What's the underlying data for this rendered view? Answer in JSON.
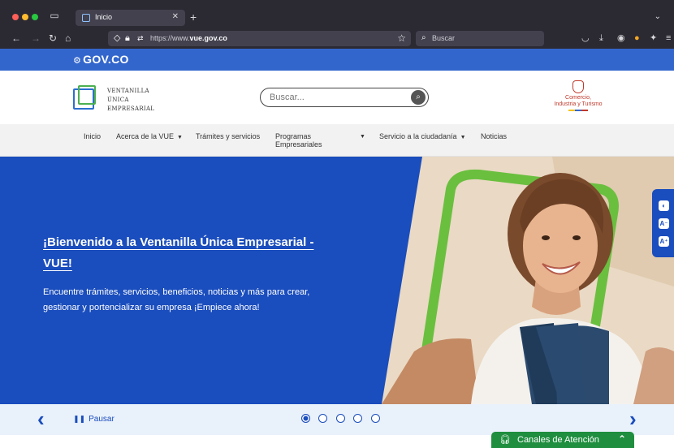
{
  "browser": {
    "tab_title": "Inicio",
    "tab_close": "✕",
    "new_tab": "+",
    "url_prefix": "https://www.",
    "url_domain": "vue.gov.co",
    "search_placeholder": "Buscar"
  },
  "gov_bar": {
    "logo": "GOV.CO"
  },
  "header": {
    "vue_logo_lines": [
      "VENTANILLA",
      "ÚNICA",
      "EMPRESARIAL"
    ],
    "search_placeholder": "Buscar...",
    "ministry_line1": "Comercio,",
    "ministry_line2": "Industria y Turismo"
  },
  "menu": {
    "items": [
      {
        "label": "Inicio",
        "dropdown": false
      },
      {
        "label": "Acerca de la VUE",
        "dropdown": true
      },
      {
        "label": "Trámites y servicios",
        "dropdown": false
      },
      {
        "label_line1": "Programas",
        "label_line2": "Empresariales",
        "dropdown": true
      },
      {
        "label": "Servicio a la ciudadanía",
        "dropdown": true
      },
      {
        "label": "Noticias",
        "dropdown": false
      }
    ]
  },
  "hero": {
    "title": "¡Bienvenido a la Ventanilla Única Empresarial - VUE!",
    "body": "Encuentre trámites, servicios, beneficios, noticias y más para crear, gestionar y portencializar su empresa ¡Empiece ahora!"
  },
  "carousel": {
    "pause_label": "Pausar",
    "slide_count": 5,
    "active_slide": 1
  },
  "canales": {
    "label": "Canales de Atención"
  },
  "colors": {
    "gov_blue": "#3366cc",
    "hero_blue": "#1a4dbd",
    "canales_green": "#1f8e3f",
    "frame_green": "#6abf3f"
  }
}
